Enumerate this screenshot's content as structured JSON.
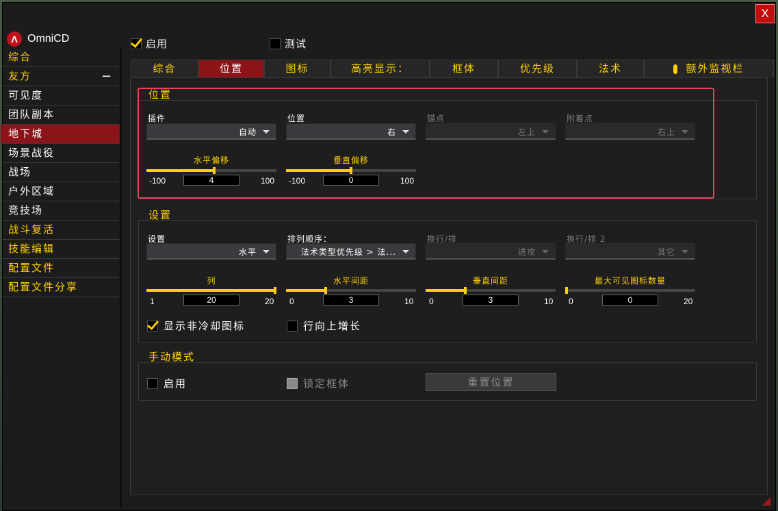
{
  "app": {
    "name": "OmniCD",
    "close_label": "X"
  },
  "header": {
    "enable_label": "启用",
    "test_label": "测试"
  },
  "sidebar": {
    "items": [
      {
        "label": "综合"
      },
      {
        "label": "友方",
        "toggle": "−"
      },
      {
        "label": "可见度"
      },
      {
        "label": "团队副本"
      },
      {
        "label": "地下城"
      },
      {
        "label": "场景战役"
      },
      {
        "label": "战场"
      },
      {
        "label": "户外区域"
      },
      {
        "label": "竞技场"
      },
      {
        "label": "战斗复活"
      },
      {
        "label": "技能编辑"
      },
      {
        "label": "配置文件"
      },
      {
        "label": "配置文件分享"
      }
    ]
  },
  "tabs": [
    {
      "label": "综合"
    },
    {
      "label": "位置"
    },
    {
      "label": "图标"
    },
    {
      "label": "高亮显示："
    },
    {
      "label": "框体"
    },
    {
      "label": "优先级"
    },
    {
      "label": "法术"
    },
    {
      "label": "额外监视栏"
    }
  ],
  "position_group": {
    "title": "位置",
    "addon": {
      "label": "插件",
      "value": "自动"
    },
    "position": {
      "label": "位置",
      "value": "右"
    },
    "anchor": {
      "label": "锚点",
      "value": "左上"
    },
    "attach": {
      "label": "附着点",
      "value": "右上"
    },
    "offset_x": {
      "label": "水平偏移",
      "min": "-100",
      "max": "100",
      "value": "4",
      "fraction": 0.52
    },
    "offset_y": {
      "label": "垂直偏移",
      "min": "-100",
      "max": "100",
      "value": "0",
      "fraction": 0.5
    }
  },
  "settings_group": {
    "title": "设置",
    "layout": {
      "label": "设置",
      "value": "水平"
    },
    "sort": {
      "label": "排列顺序：",
      "value": "法术类型优先级 > 法..."
    },
    "wrap": {
      "label": "换行/排",
      "value": "进攻"
    },
    "wrap2": {
      "label": "换行/排 2",
      "value": "其它"
    },
    "columns": {
      "label": "列",
      "min": "1",
      "max": "20",
      "value": "20",
      "fraction": 1.0
    },
    "h_spacing": {
      "label": "水平间距",
      "min": "0",
      "max": "10",
      "value": "3",
      "fraction": 0.3
    },
    "v_spacing": {
      "label": "垂直间距",
      "min": "0",
      "max": "10",
      "value": "3",
      "fraction": 0.3
    },
    "max_icons": {
      "label": "最大可见图标数量",
      "min": "0",
      "max": "20",
      "value": "0",
      "fraction": 0.0
    },
    "show_noncd_label": "显示非冷却图标",
    "grow_up_label": "行向上增长"
  },
  "manual_group": {
    "title": "手动模式",
    "enable_label": "启用",
    "lock_label": "锁定框体",
    "reset_label": "重置位置"
  },
  "colors": {
    "accent": "#ffd100",
    "active": "#8c1318",
    "highlight": "#e44659"
  }
}
